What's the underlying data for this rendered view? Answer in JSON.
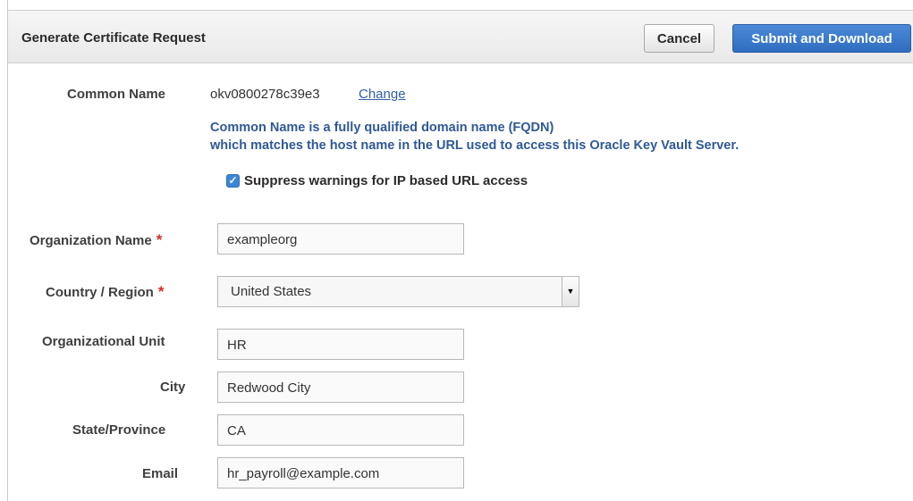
{
  "header": {
    "title": "Generate Certificate Request",
    "cancel_label": "Cancel",
    "submit_label": "Submit and Download"
  },
  "common_name": {
    "label": "Common Name",
    "value": "okv0800278c39e3",
    "change_link": "Change",
    "help_line1": "Common Name is a fully qualified domain name (FQDN)",
    "help_line2": "which matches the host name in the URL used to access this Oracle Key Vault Server.",
    "suppress_label": "Suppress warnings for IP based URL access",
    "suppress_checked": true
  },
  "fields": {
    "organization_name": {
      "label": "Organization Name",
      "value": "exampleorg",
      "required": true
    },
    "country_region": {
      "label": "Country / Region",
      "value": "United States",
      "required": true
    },
    "organizational_unit": {
      "label": "Organizational Unit",
      "value": "HR"
    },
    "city": {
      "label": "City",
      "value": "Redwood City"
    },
    "state_province": {
      "label": "State/Province",
      "value": "CA"
    },
    "email": {
      "label": "Email",
      "value": "hr_payroll@example.com"
    }
  },
  "colors": {
    "primary_button": "#2f6cbf",
    "help_text": "#2f5996",
    "required_marker": "#d42a2a"
  },
  "icons": {
    "checkbox": "check-icon",
    "select": "dropdown-arrow-icon"
  },
  "required_marker": "*"
}
